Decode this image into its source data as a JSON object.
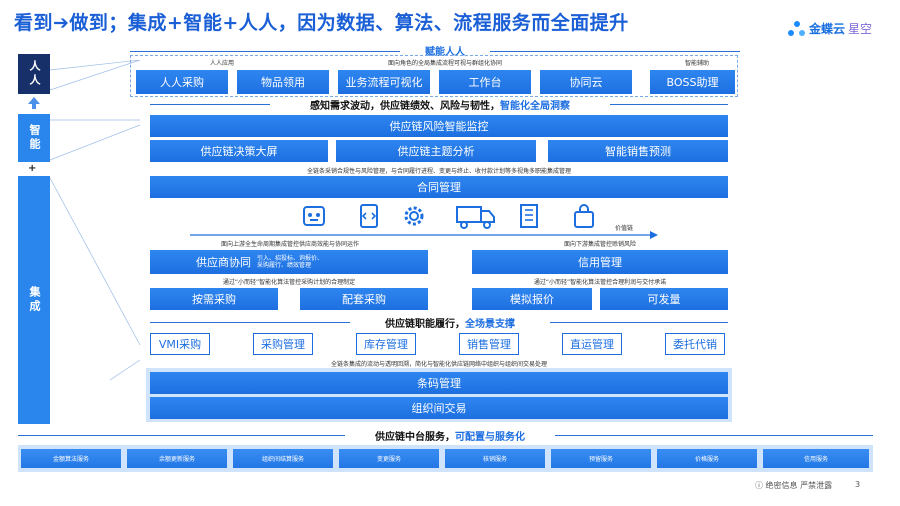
{
  "title": "看到➔做到；集成+智能+人人，因为数据、算法、流程服务而全面提升",
  "logo": {
    "brand": "金蝶云",
    "sub": "星空"
  },
  "left_labels": {
    "renren": "人人",
    "zhineng": "智能",
    "plus": "+",
    "jicheng": "集成"
  },
  "top_section": {
    "title": "赋能人人",
    "subtitle": "面向角色的全局集成流程可视与群组化协同",
    "left_caption": "人人应用",
    "right_caption": "智能辅助",
    "apps": [
      "人人采购",
      "物品领用",
      "业务流程可视化",
      "工作台",
      "协同云",
      "BOSS助理"
    ]
  },
  "section2": {
    "title": "感知需求波动，供应链绩效、风险与韧性，",
    "highlight": "智能化全局洞察"
  },
  "risk_monitor": "供应链风险智能监控",
  "analytics": [
    "供应链决策大屏",
    "供应链主题分析",
    "智能销售预测"
  ],
  "note_contract": "全链条采销合规性与风险管理，与合同履行进程、变更与终止、收付款计划等多视角多职能集成管理",
  "contract": "合同管理",
  "value_chain_label": "价值链",
  "icons": [
    "robot-icon",
    "code-document-icon",
    "gear-icon",
    "truck-icon",
    "building-icon",
    "shopping-bag-icon"
  ],
  "upstream_note": "面向上游全生命周期集成管控供应商效能与协同运作",
  "downstream_note": "面向下游集成管控赊销风险",
  "supplier": {
    "label": "供应商协同",
    "detail1": "引入、招投标、询报价、",
    "detail2": "采购履行、绩效管理"
  },
  "credit": "信用管理",
  "note_left_algo": "通过“小而轻”智能化算法管控采购计划的合理制定",
  "note_right_algo": "通过“小而轻”智能化算法管控合理利润与交付承诺",
  "procure": [
    "按需采购",
    "配套采购"
  ],
  "sales": [
    "模拟报价",
    "可发量"
  ],
  "section3": {
    "title": "供应链职能履行，",
    "highlight": "全场景支撑"
  },
  "functions": [
    "VMI采购",
    "采购管理",
    "库存管理",
    "销售管理",
    "直运管理",
    "委托代销"
  ],
  "note_integration": "全链条集成的流动与透明回溯，简化与智能化供应链网络中组织与组织间交易处理",
  "barcode": "条码管理",
  "org_trade": "组织间交易",
  "section4": {
    "title": "供应链中台服务，",
    "highlight": "可配置与服务化"
  },
  "services": [
    "金额算法服务",
    "余额更新服务",
    "组织间结算服务",
    "变更服务",
    "核销服务",
    "预留服务",
    "价格服务",
    "信用服务"
  ],
  "footer": {
    "confidential": "绝密信息 严禁泄露",
    "page": "3"
  }
}
